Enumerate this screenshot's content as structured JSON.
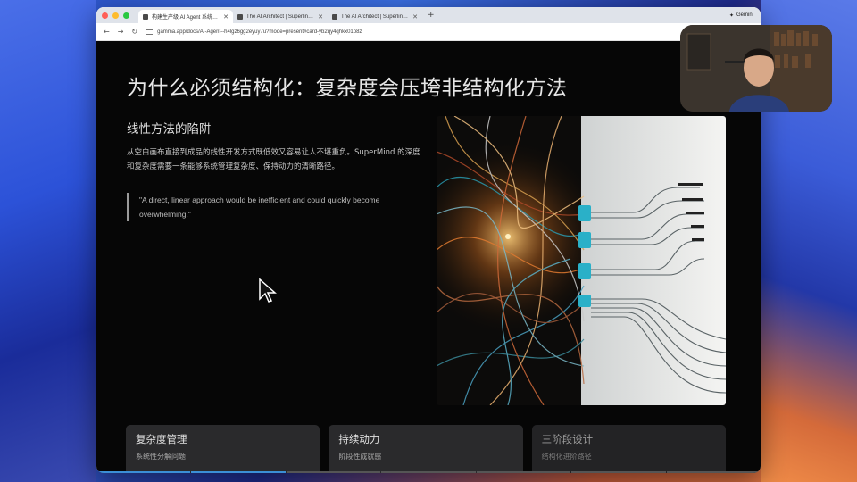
{
  "browser": {
    "tabs": [
      {
        "label": "构建生产级 AI Agent 系统的框",
        "active": true
      },
      {
        "label": "The AI Architect | Superlinear",
        "active": false
      },
      {
        "label": "The AI Architect | Superlinear",
        "active": false
      }
    ],
    "gemini_label": "Gemini",
    "url": "gamma.app/docs/AI-Agent--h4lgz6gg2eyuy7u?mode=present#card-yb2qy4qhkx01o8z"
  },
  "slide": {
    "title": "为什么必须结构化：复杂度会压垮非结构化方法",
    "subheading": "线性方法的陷阱",
    "paragraph": "从空白画布直接到成品的线性开发方式既低效又容易让人不堪重负。SuperMind 的深度和复杂度需要一条能够系统管理复杂度、保持动力的清晰路径。",
    "quote": "\"A direct, linear approach would be inefficient and could quickly become overwhelming.\"",
    "cards": [
      {
        "title": "复杂度管理",
        "subtitle": "系统性分解问题"
      },
      {
        "title": "持续动力",
        "subtitle": "阶段性成就感"
      },
      {
        "title": "三阶段设计",
        "subtitle": "结构化进阶路径"
      }
    ],
    "progress": {
      "total_segments": 7,
      "current": 2
    }
  },
  "colors": {
    "slide_bg": "#060606",
    "accent": "#3b8fd6",
    "cable_teal": "#2ab0c8"
  },
  "icons": [
    "back-icon",
    "forward-icon",
    "reload-icon",
    "site-settings-icon",
    "cast-icon",
    "bookmark-star-icon",
    "gemini-icon",
    "mouse-cursor-icon"
  ]
}
